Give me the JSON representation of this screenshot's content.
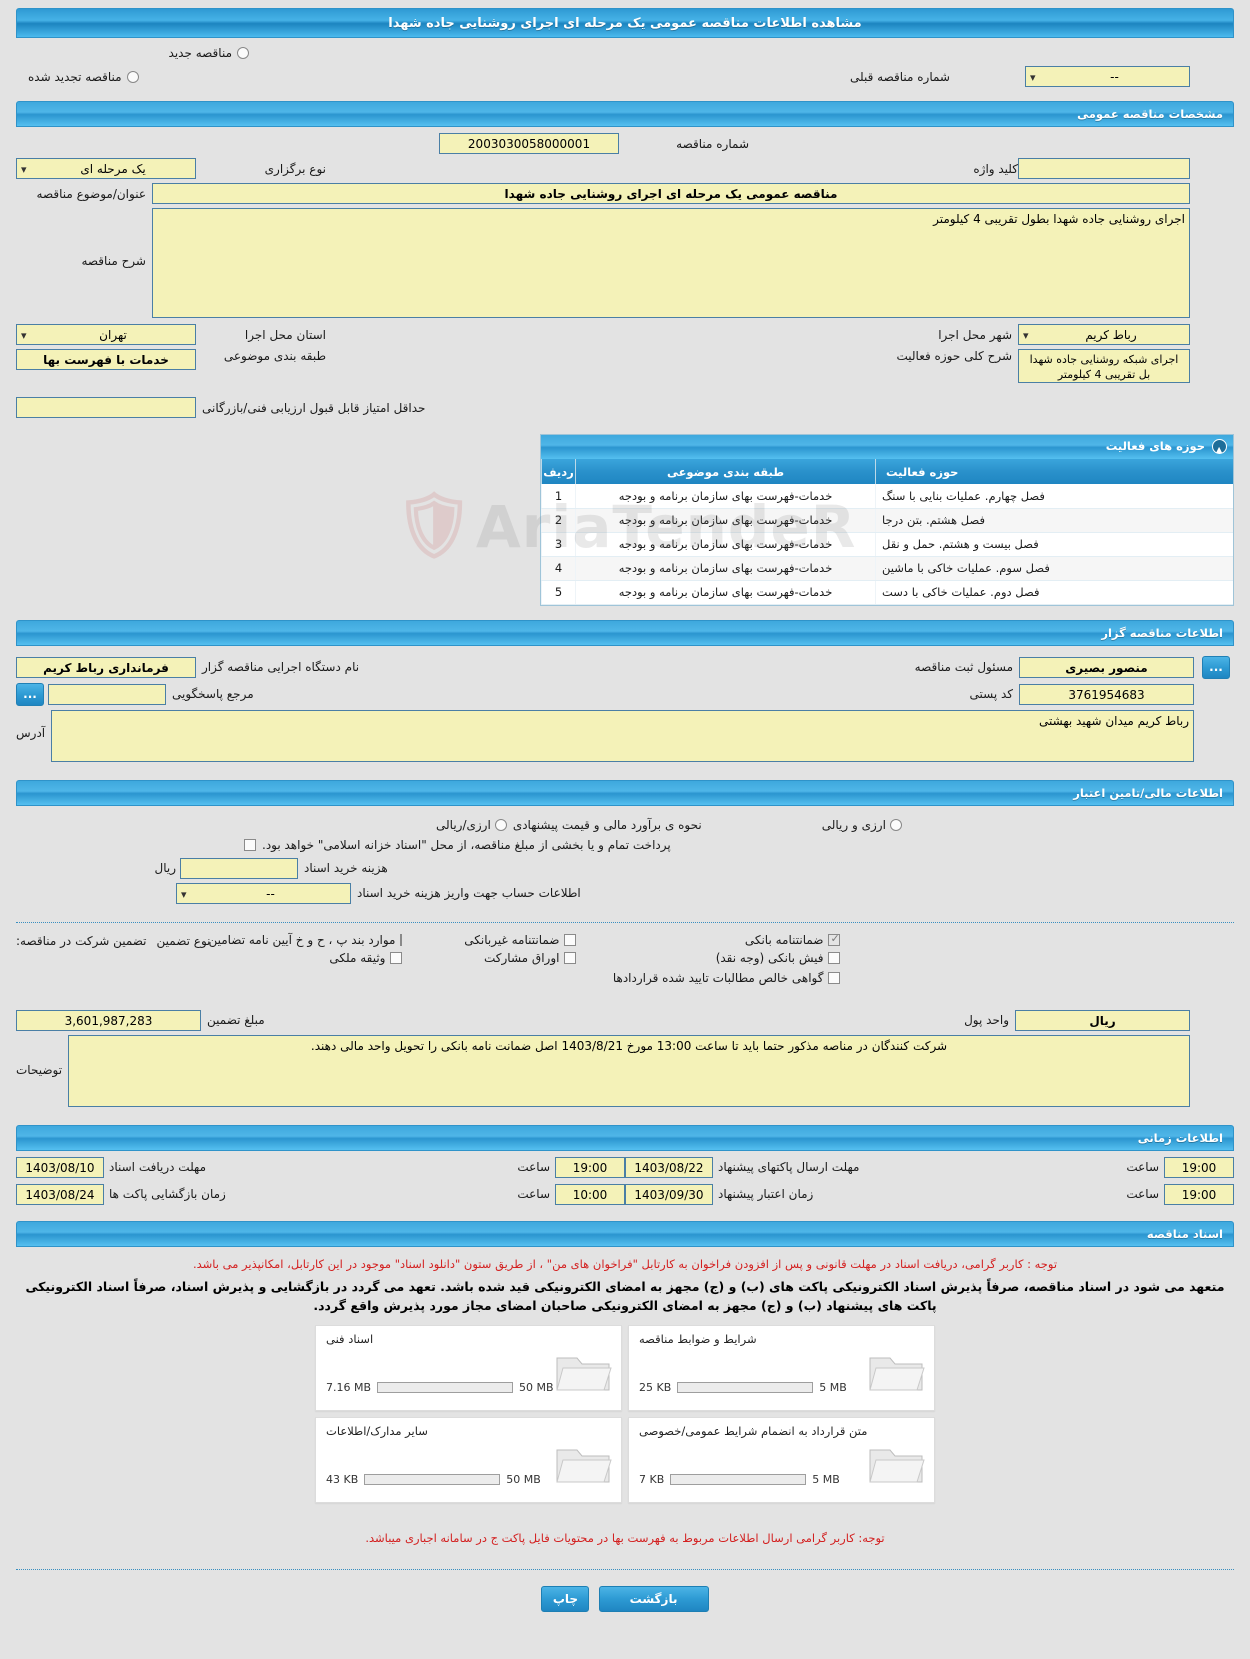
{
  "header": {
    "title": "مشاهده اطلاعات مناقصه عمومی یک مرحله ای اجرای روشنایی جاده شهدا"
  },
  "tender_type": {
    "new_label": "مناقصه جدید",
    "renewed_label": "مناقصه تجدید شده",
    "prev_number_label": "شماره مناقصه قبلی",
    "prev_number_value": "--"
  },
  "general": {
    "section_title": "مشخصات مناقصه عمومی",
    "number_label": "شماره مناقصه",
    "number_value": "2003030058000001",
    "type_label": "نوع برگزاری",
    "type_value": "یک مرحله ای",
    "keyword_label": "کلید واژه",
    "keyword_value": "",
    "title_label": "عنوان/موضوع مناقصه",
    "title_value": "مناقصه عمومی یک مرحله ای اجرای روشنایی جاده شهدا",
    "desc_label": "شرح مناقصه",
    "desc_value": "اجرای روشنایی جاده شهدا بطول تقریبی 4 کیلومتر",
    "province_label": "استان محل اجرا",
    "province_value": "تهران",
    "city_label": "شهر محل اجرا",
    "city_value": "رباط کریم",
    "subject_class_label": "طبقه بندی موضوعی",
    "subject_class_value": "خدمات با فهرست بها",
    "activity_desc_label": "شرح کلی حوزه فعالیت",
    "activity_desc_value": "اجرای شبکه روشنایی جاده شهدا بل تقریبی 4 کیلومتر",
    "min_score_label": "حداقل امتیاز قابل قبول ارزیابی فنی/بازرگانی",
    "min_score_value": ""
  },
  "activities": {
    "section_title": "حوزه های فعالیت",
    "columns": {
      "row": "ردیف",
      "subject": "طبقه بندی موضوعی",
      "domain": "حوزه فعالیت"
    },
    "rows": [
      {
        "row": "1",
        "subject": "خدمات-فهرست بهای سازمان برنامه و بودجه",
        "domain": "فصل چهارم. عملیات بنایی با سنگ"
      },
      {
        "row": "2",
        "subject": "خدمات-فهرست بهای سازمان برنامه و بودجه",
        "domain": "فصل هشتم. بتن درجا"
      },
      {
        "row": "3",
        "subject": "خدمات-فهرست بهای سازمان برنامه و بودجه",
        "domain": "فصل بیست و هشتم. حمل و نقل"
      },
      {
        "row": "4",
        "subject": "خدمات-فهرست بهای سازمان برنامه و بودجه",
        "domain": "فصل سوم. عملیات خاکی با ماشین"
      },
      {
        "row": "5",
        "subject": "خدمات-فهرست بهای سازمان برنامه و بودجه",
        "domain": "فصل دوم. عملیات خاکی با دست"
      }
    ]
  },
  "organizer": {
    "section_title": "اطلاعات مناقصه گزار",
    "agency_label": "نام دستگاه اجرایی مناقصه گزار",
    "agency_value": "فرمانداری رباط کریم",
    "registrar_label": "مسئول ثبت مناقصه",
    "registrar_value": "منصور بصیری",
    "contact_label": "مرجع پاسخگویی",
    "contact_value": "",
    "postal_label": "کد پستی",
    "postal_value": "3761954683",
    "address_label": "آدرس",
    "address_value": "رباط کریم میدان شهید بهشتی",
    "dots_button": "..."
  },
  "finance": {
    "section_title": "اطلاعات مالی/تامین اعتبار",
    "estimate_label": "نحوه ی برآورد مالی و قیمت پیشنهادی",
    "opt_rial": "ارزی/ریالی",
    "opt_both": "ارزی و ریالی",
    "treasury_note": "پرداخت تمام و یا بخشی از مبلغ مناقصه، از محل \"اسناد خزانه اسلامی\" خواهد بود.",
    "doc_cost_label": "هزینه خرید اسناد",
    "doc_cost_value": "",
    "doc_cost_unit": "ریال",
    "account_label": "اطلاعات حساب جهت واریز هزینه خرید اسناد",
    "account_value": "--"
  },
  "guarantee": {
    "participation_label": "تضمین شرکت در مناقصه:",
    "type_label": "نوع تضمین",
    "options": [
      {
        "label": "ضمانتنامه بانکی",
        "checked": true
      },
      {
        "label": "ضمانتنامه غیربانکی",
        "checked": false
      },
      {
        "label": "موارد بند پ ، ح و خ آیین نامه تضامین",
        "checked": false
      },
      {
        "label": "فیش بانکی (وجه نقد)",
        "checked": false
      },
      {
        "label": "اوراق مشارکت",
        "checked": false
      },
      {
        "label": "وثیقه ملکی",
        "checked": false
      },
      {
        "label": "گواهی خالص مطالبات تایید شده قراردادها",
        "checked": false
      }
    ],
    "amount_label": "مبلغ تضمین",
    "amount_value": "3,601,987,283",
    "currency_label": "واحد پول",
    "currency_value": "ریال",
    "notes_label": "توضیحات",
    "notes_value": "شرکت کنندگان در مناصه مذکور حتما باید تا ساعت 13:00 مورخ 1403/8/21 اصل ضمانت نامه بانکی را تحویل واحد مالی دهند."
  },
  "timing": {
    "section_title": "اطلاعات زمانی",
    "hour_label": "ساعت",
    "rows": [
      {
        "label": "مهلت دریافت اسناد",
        "date": "1403/08/10",
        "time": "19:00"
      },
      {
        "label": "زمان بازگشایی پاکت ها",
        "date": "1403/08/24",
        "time": "10:00"
      },
      {
        "label": "مهلت ارسال پاکتهای پیشنهاد",
        "date": "1403/08/22",
        "time": "19:00"
      },
      {
        "label": "زمان اعتبار پیشنهاد",
        "date": "1403/09/30",
        "time": "19:00"
      }
    ]
  },
  "documents": {
    "section_title": "اسناد مناقصه",
    "note_red_1": "توجه : کاربر گرامی، دریافت اسناد در مهلت قانونی و پس از افزودن فراخوان به کارتابل \"فراخوان های من\" ، از طریق ستون \"دانلود اسناد\" موجود در این کارتابل، امکانپذیر می باشد.",
    "note_black": "متعهد می شود در اسناد مناقصه، صرفاً پذیرش اسناد الکترونیکی پاکت های (ب) و (ج) مجهز به امضای الکترونیکی قید شده باشد. تعهد می گردد در بازگشایی و پذیرش اسناد، صرفاً اسناد الکترونیکی پاکت های پیشنهاد (ب) و (ج) مجهز به امضای الکترونیکی صاحبان امضای مجاز مورد پذیرش واقع گردد.",
    "note_red_2": "توجه: کاربر گرامی ارسال اطلاعات مربوط به فهرست بها در محتویات فایل پاکت ج در سامانه اجباری میباشد.",
    "cards": [
      {
        "title": "شرایط و ضوابط مناقصه",
        "size": "25 KB",
        "limit": "5 MB",
        "pct": 1
      },
      {
        "title": "اسناد فنی",
        "size": "7.16 MB",
        "limit": "50 MB",
        "pct": 15
      },
      {
        "title": "متن قرارداد به انضمام شرایط عمومی/خصوصی",
        "size": "7 KB",
        "limit": "5 MB",
        "pct": 1
      },
      {
        "title": "سایر مدارک/اطلاعات",
        "size": "43 KB",
        "limit": "50 MB",
        "pct": 1
      }
    ]
  },
  "footer": {
    "back_label": "بازگشت",
    "print_label": "چاپ"
  },
  "watermark": {
    "text": "AriaTendeR"
  },
  "colors": {
    "accent": "#2f93c9",
    "field_bg": "#f4f2b8",
    "alert": "#d32020",
    "progress": "#8cc63e"
  }
}
